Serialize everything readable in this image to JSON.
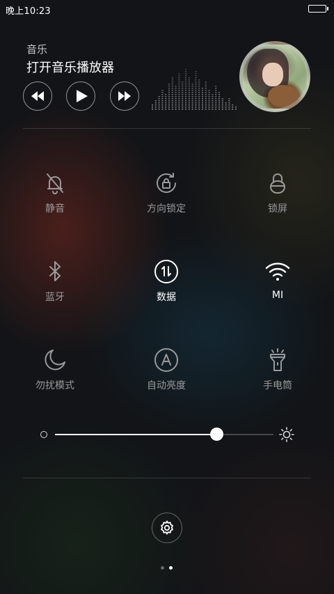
{
  "status_bar": {
    "time": "晚上10:23"
  },
  "music": {
    "label": "音乐",
    "title": "打开音乐播放器",
    "controls": [
      "previous-icon",
      "play-icon",
      "next-icon"
    ]
  },
  "toggles": [
    {
      "id": "mute",
      "label": "静音",
      "icon": "bell-off-icon",
      "active": false
    },
    {
      "id": "rotation-lock",
      "label": "方向锁定",
      "icon": "rotation-lock-icon",
      "active": false
    },
    {
      "id": "lock-screen",
      "label": "锁屏",
      "icon": "lock-icon",
      "active": false
    },
    {
      "id": "bluetooth",
      "label": "蓝牙",
      "icon": "bluetooth-icon",
      "active": false
    },
    {
      "id": "data",
      "label": "数据",
      "icon": "mobile-data-icon",
      "active": true
    },
    {
      "id": "wifi",
      "label": "MI",
      "icon": "wifi-icon",
      "active": true
    },
    {
      "id": "do-not-disturb",
      "label": "勿扰模式",
      "icon": "moon-icon",
      "active": false
    },
    {
      "id": "auto-brightness",
      "label": "自动亮度",
      "icon": "auto-brightness-icon",
      "active": false
    },
    {
      "id": "flashlight",
      "label": "手电筒",
      "icon": "flashlight-icon",
      "active": false
    }
  ],
  "brightness": {
    "level": 0.74
  },
  "pager": {
    "count": 2,
    "active": 1
  },
  "colors": {
    "active": "#ffffff",
    "inactive": "#9a9a9a"
  }
}
